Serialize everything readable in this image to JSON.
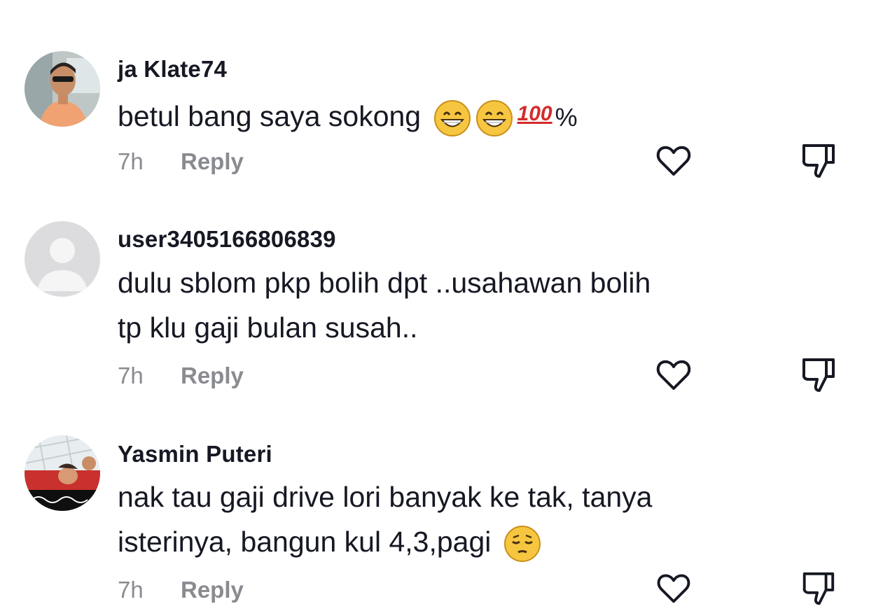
{
  "comments": [
    {
      "username": "ja Klate74",
      "lines": [
        "betul bang saya sokong"
      ],
      "emoji": [
        "grinning-face",
        "grinning-face",
        "hundred-points"
      ],
      "emoji_hundred_text": "100",
      "suffix": "%",
      "time": "7h",
      "reply_label": "Reply",
      "avatar": "photo-man-sunglasses"
    },
    {
      "username": "user3405166806839",
      "lines": [
        "dulu sblom pkp bolih dpt ..usahawan bolih",
        "tp klu gaji bulan susah.."
      ],
      "time": "7h",
      "reply_label": "Reply",
      "avatar": "default-gray-avatar"
    },
    {
      "username": "Yasmin Puteri",
      "lines": [
        "nak tau gaji drive lori banyak ke tak, tanya",
        "isterinya, bangun kul 4,3,pagi"
      ],
      "emoji": [
        "pensive-face"
      ],
      "time": "7h",
      "reply_label": "Reply",
      "avatar": "photo-children-banner"
    }
  ],
  "icons": {
    "like": "heart-outline-icon",
    "dislike": "thumbs-down-outline-icon"
  },
  "colors": {
    "text": "#161823",
    "meta": "#8a8b91",
    "icon": "#161823",
    "emoji_face": "#f7c640",
    "hundred": "#d32b2b"
  }
}
